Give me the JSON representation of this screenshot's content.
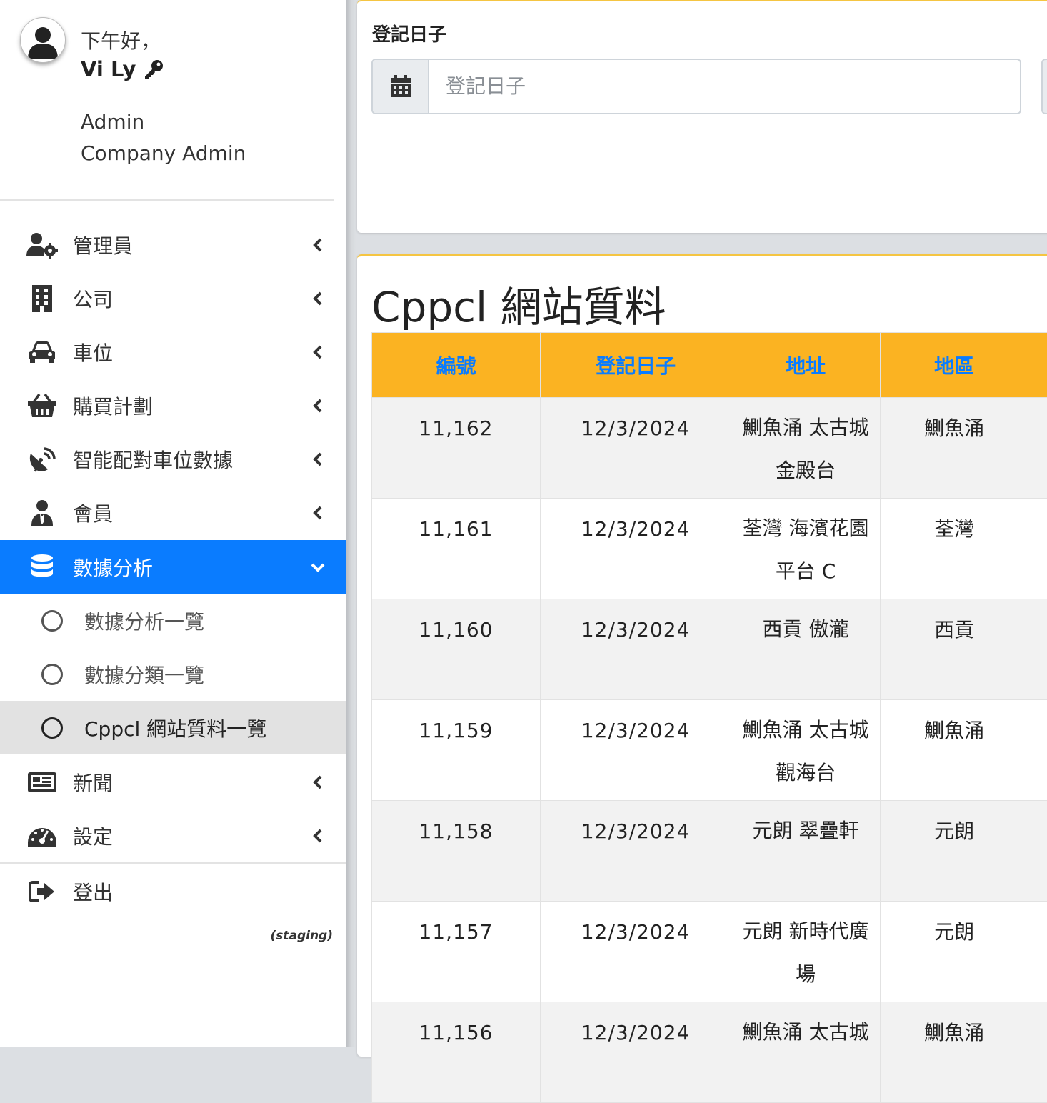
{
  "user": {
    "greeting": "下午好，",
    "name": "Vi Ly",
    "role": "Admin",
    "company_role": "Company Admin"
  },
  "sidebar": {
    "items": [
      {
        "label": "管理員",
        "icon": "users-cog-icon"
      },
      {
        "label": "公司",
        "icon": "building-icon"
      },
      {
        "label": "車位",
        "icon": "car-icon"
      },
      {
        "label": "購買計劃",
        "icon": "basket-icon"
      },
      {
        "label": "智能配對車位數據",
        "icon": "satellite-dish-icon"
      },
      {
        "label": "會員",
        "icon": "user-tie-icon"
      },
      {
        "label": "數據分析",
        "icon": "database-icon",
        "active": true
      },
      {
        "label": "新聞",
        "icon": "newspaper-icon"
      },
      {
        "label": "設定",
        "icon": "tachometer-icon"
      },
      {
        "label": "登出",
        "icon": "sign-out-icon"
      }
    ],
    "submenu": [
      {
        "label": "數據分析一覽"
      },
      {
        "label": "數據分類一覽"
      },
      {
        "label": "Cppcl 網站質料一覽",
        "current": true
      }
    ],
    "environment": "(staging)"
  },
  "filter": {
    "date_label": "登記日子",
    "date_placeholder": "登記日子"
  },
  "table": {
    "title": "Cppcl 網站質料",
    "headers": [
      "編號",
      "登記日子",
      "地址",
      "地區"
    ],
    "rows": [
      {
        "id": "11,162",
        "date": "12/3/2024",
        "address_line1": "鰂魚涌 太古城",
        "address_line2": "金殿台",
        "district": "鰂魚涌"
      },
      {
        "id": "11,161",
        "date": "12/3/2024",
        "address_line1": "荃灣 海濱花園",
        "address_line2": "平台 C",
        "district": "荃灣"
      },
      {
        "id": "11,160",
        "date": "12/3/2024",
        "address_line1": "西貢 傲瀧",
        "address_line2": "",
        "district": "西貢"
      },
      {
        "id": "11,159",
        "date": "12/3/2024",
        "address_line1": "鰂魚涌 太古城",
        "address_line2": "觀海台",
        "district": "鰂魚涌"
      },
      {
        "id": "11,158",
        "date": "12/3/2024",
        "address_line1": "元朗 翠疊軒",
        "address_line2": "",
        "district": "元朗"
      },
      {
        "id": "11,157",
        "date": "12/3/2024",
        "address_line1": "元朗 新時代廣",
        "address_line2": "場",
        "district": "元朗"
      },
      {
        "id": "11,156",
        "date": "12/3/2024",
        "address_line1": "鰂魚涌 太古城",
        "address_line2": "",
        "district": "鰂魚涌"
      }
    ]
  },
  "colors": {
    "accent": "#0a7cff",
    "header_bg": "#fbb322",
    "card_border": "#f5c542"
  }
}
